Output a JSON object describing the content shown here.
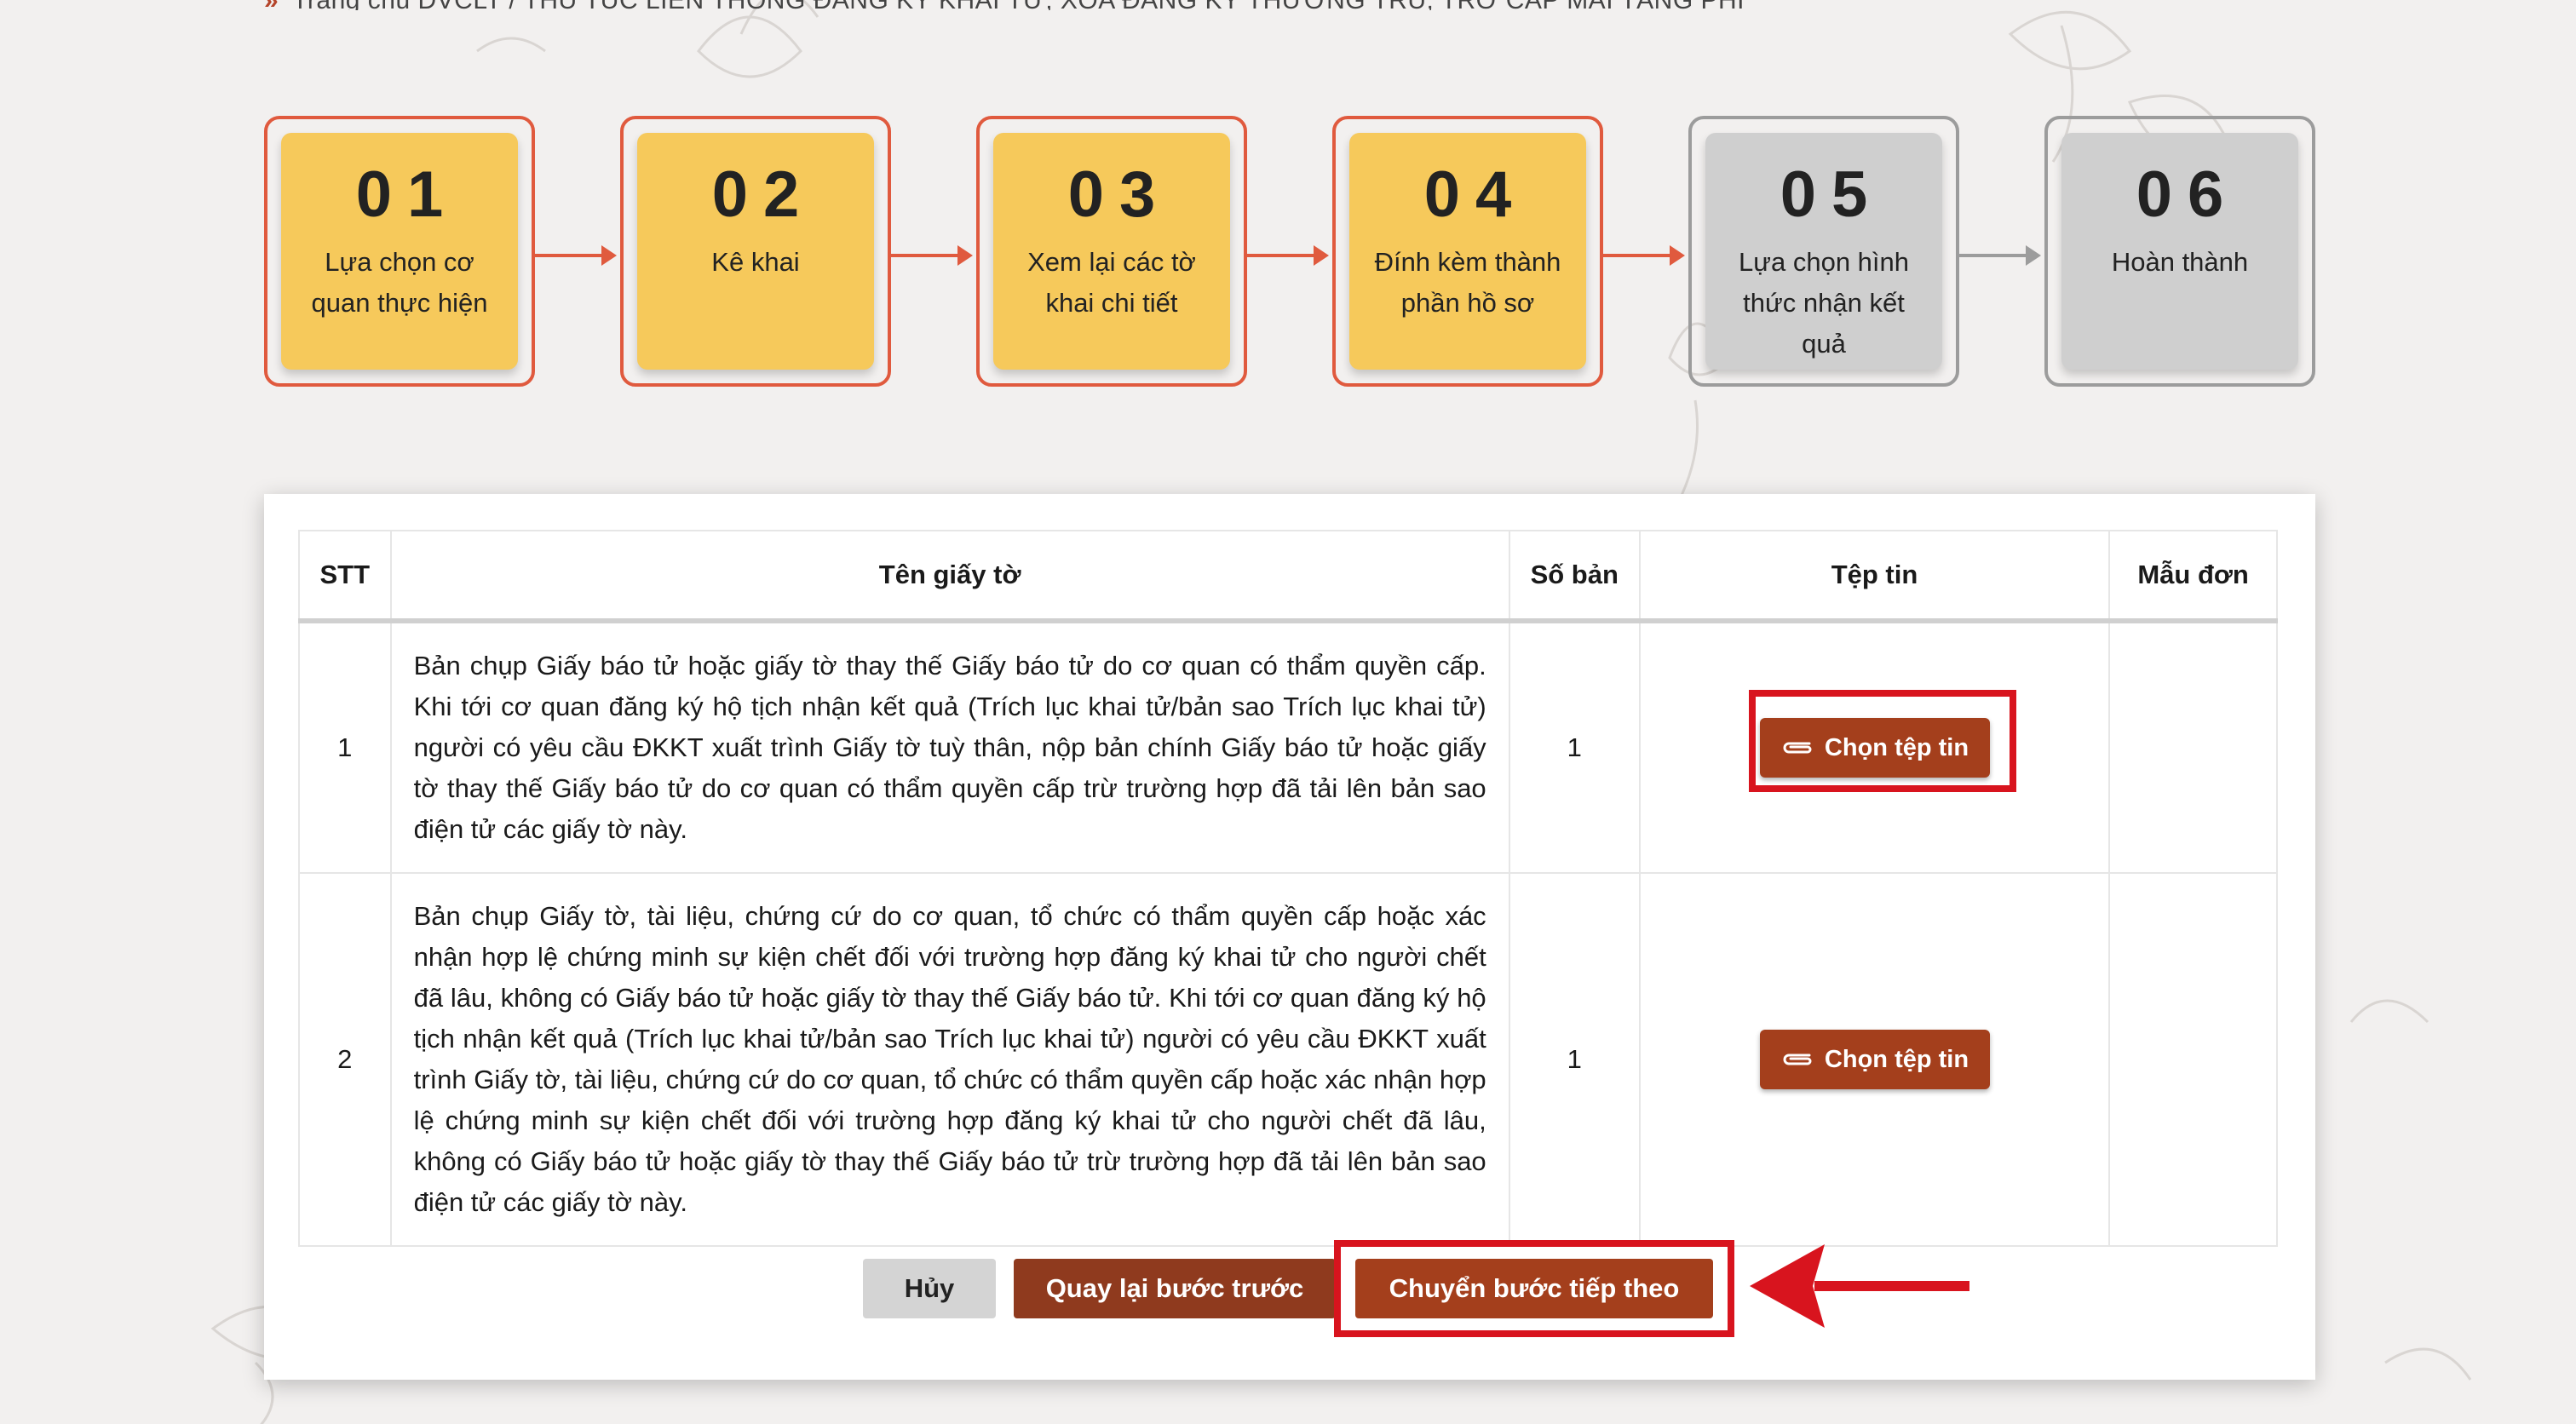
{
  "breadcrumb": {
    "text": "Trang chủ DVCLT / THỦ TỤC LIÊN THÔNG ĐĂNG KÝ KHAI TỬ, XÓA ĐĂNG KÝ THƯỜNG TRÚ, TRỢ CẤP MAI TÁNG PHÍ"
  },
  "steps": [
    {
      "number": "01",
      "label": "Lựa chọn cơ quan thực hiện",
      "state": "active"
    },
    {
      "number": "02",
      "label": "Kê khai",
      "state": "active"
    },
    {
      "number": "03",
      "label": "Xem lại các tờ khai chi tiết",
      "state": "active"
    },
    {
      "number": "04",
      "label": "Đính kèm thành phần hồ sơ",
      "state": "active"
    },
    {
      "number": "05",
      "label": "Lựa chọn hình thức nhận kết quả",
      "state": "inactive"
    },
    {
      "number": "06",
      "label": "Hoàn thành",
      "state": "inactive"
    }
  ],
  "table": {
    "headers": {
      "stt": "STT",
      "name": "Tên giấy tờ",
      "copies": "Số bản",
      "file": "Tệp tin",
      "template": "Mẫu đơn"
    },
    "rows": [
      {
        "stt": "1",
        "name": "Bản chụp Giấy báo tử hoặc giấy tờ thay thế Giấy báo tử do cơ quan có thẩm quyền cấp. Khi tới cơ quan đăng ký hộ tịch nhận kết quả (Trích lục khai tử/bản sao Trích lục khai tử) người có yêu cầu ĐKKT xuất trình Giấy tờ tuỳ thân, nộp bản chính Giấy báo tử hoặc giấy tờ thay thế Giấy báo tử do cơ quan có thẩm quyền cấp trừ trường hợp đã tải lên bản sao điện tử các giấy tờ này.",
        "copies": "1",
        "file_button": "Chọn tệp tin",
        "template": ""
      },
      {
        "stt": "2",
        "name": "Bản chụp Giấy tờ, tài liệu, chứng cứ do cơ quan, tổ chức có thẩm quyền cấp hoặc xác nhận hợp lệ chứng minh sự kiện chết đối với trường hợp đăng ký khai tử cho người chết đã lâu, không có Giấy báo tử hoặc giấy tờ thay thế Giấy báo tử. Khi tới cơ quan đăng ký hộ tịch nhận kết quả (Trích lục khai tử/bản sao Trích lục khai tử) người có yêu cầu ĐKKT xuất trình Giấy tờ, tài liệu, chứng cứ do cơ quan, tổ chức có thẩm quyền cấp hoặc xác nhận hợp lệ chứng minh sự kiện chết đối với trường hợp đăng ký khai tử cho người chết đã lâu, không có Giấy báo tử hoặc giấy tờ thay thế Giấy báo tử trừ trường hợp đã tải lên bản sao điện tử các giấy tờ này.",
        "copies": "1",
        "file_button": "Chọn tệp tin",
        "template": ""
      }
    ]
  },
  "actions": {
    "cancel": "Hủy",
    "back": "Quay lại bước trước",
    "next": "Chuyển bước tiếp theo"
  },
  "colors": {
    "active_step": "#f6c95b",
    "inactive_step": "#cfcfcf",
    "step_border": "#e05a3e",
    "primary_button": "#a43f1c",
    "annotation_red": "#d8141e"
  },
  "icons": {
    "file_button_icon": "paperclip-icon",
    "breadcrumb_icon": "double-chevron-icon",
    "annotation": "red-arrow-annotation"
  }
}
